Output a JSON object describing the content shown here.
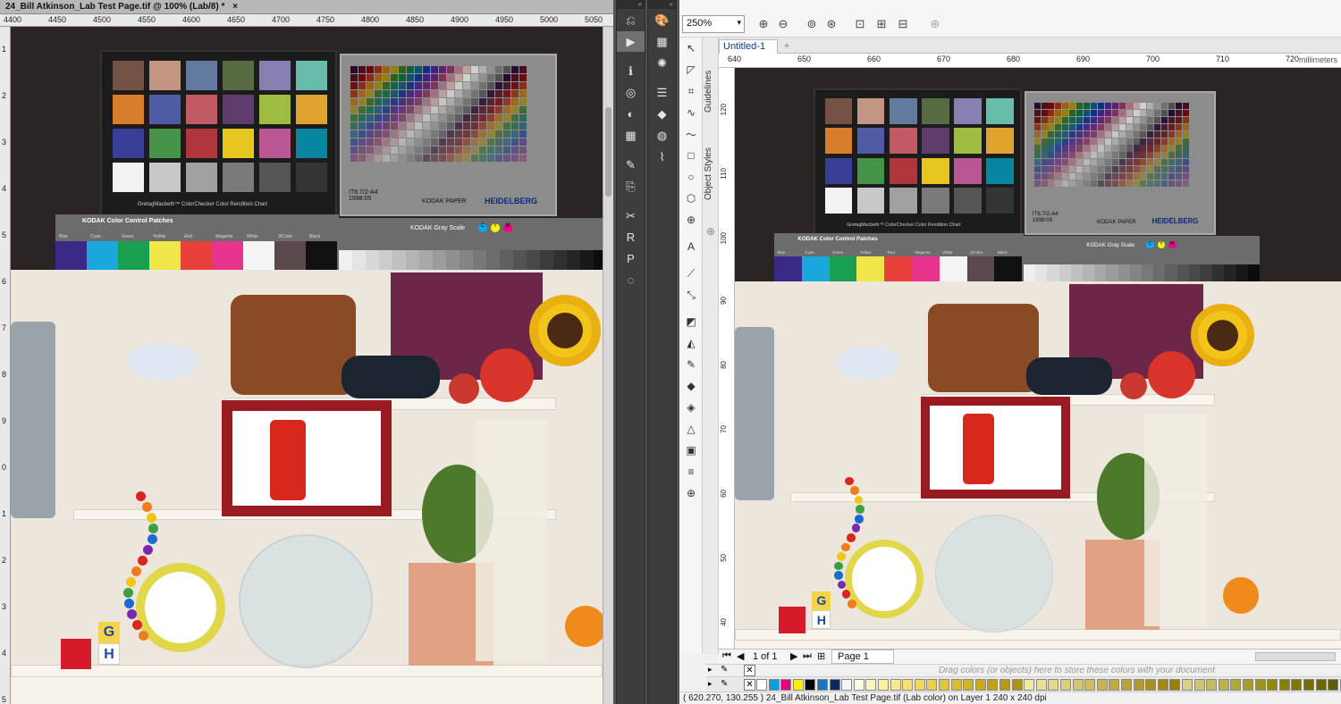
{
  "photoshop": {
    "tab_title": "24_Bill Atkinson_Lab Test Page.tif @ 100% (Lab/8) *",
    "close_glyph": "×",
    "ruler_top_ticks": [
      "4400",
      "4450",
      "4500",
      "4550",
      "4600",
      "4650",
      "4700",
      "4750",
      "4800",
      "4850",
      "4900",
      "4950",
      "5000",
      "5050"
    ],
    "ruler_left_ticks": [
      "1",
      "2",
      "3",
      "4",
      "5",
      "6",
      "7",
      "8",
      "9",
      "0",
      "1",
      "2",
      "3",
      "4",
      "5"
    ]
  },
  "test_image": {
    "colorchecker_caption": "GretagMacbeth™ ColorChecker Color Rendition Chart",
    "it8_label": "IT8.7/2-A4 1998:05",
    "kodak_paper": "KODAK PAPER",
    "heidelberg": "HEIDELBERG",
    "kodak_patches_title": "KODAK Color Control Patches",
    "kodak_patch_names": [
      "Blue",
      "Cyan",
      "Green",
      "Yellow",
      "Red",
      "Magenta",
      "White",
      "3/Color",
      "Black"
    ],
    "kodak_gray_title": "KODAK Gray Scale",
    "cmy": [
      "C",
      "Y",
      "M"
    ],
    "cube_letters": [
      "G",
      "H"
    ],
    "colors": {
      "colorchecker": [
        "#735244",
        "#c29682",
        "#627a9d",
        "#576c43",
        "#8580b1",
        "#67bdaa",
        "#d67e2c",
        "#505ba6",
        "#c15a63",
        "#5e3c6c",
        "#9dbc40",
        "#e0a32e",
        "#383d96",
        "#469449",
        "#af363c",
        "#e7c71f",
        "#bb5695",
        "#0885a1",
        "#f3f3f2",
        "#c8c8c8",
        "#a0a0a0",
        "#7a7a79",
        "#555555",
        "#343434"
      ],
      "kodak_patches": [
        "#3a2a86",
        "#1aa7dc",
        "#18a050",
        "#f0e64a",
        "#e8403a",
        "#e8338c",
        "#f4f4f4",
        "#5a4a4e",
        "#111111"
      ]
    }
  },
  "tool_strips": {
    "left": [
      "history-brush-icon",
      "play-icon",
      "info-icon",
      "color-wheel-icon",
      "adjustment-icon",
      "crop-extract-icon",
      "brush-settings-icon",
      "stamp-icon",
      "scissors-icon",
      "paragraph-style-icon",
      "paragraph-icon",
      "character-style-icon"
    ],
    "right": [
      "palette-icon",
      "grid-icon",
      "sun-icon",
      "sliders-icon",
      "layers-icon",
      "channels-icon",
      "path-icon"
    ],
    "glyphs_left": [
      "⎌",
      "▶",
      "ℹ",
      "◎",
      "◐",
      "▦",
      "✎",
      "⎘",
      "✂",
      "R",
      "P",
      "◌"
    ],
    "glyphs_right": [
      "🎨",
      "▦",
      "✺",
      "☰",
      "◆",
      "◍",
      "⌇"
    ]
  },
  "corel": {
    "zoom": "250%",
    "document_tab": "Untitled-1",
    "units": "millimeters",
    "ruler_top_ticks": [
      "640",
      "650",
      "660",
      "670",
      "680",
      "690",
      "700",
      "710",
      "720"
    ],
    "ruler_left_ticks": [
      "120",
      "110",
      "100",
      "90",
      "80",
      "70",
      "60",
      "50",
      "40"
    ],
    "dock_tabs": [
      "Guidelines",
      "Object Styles"
    ],
    "page_nav": "1 of 1",
    "page_tab": "Page 1",
    "doc_palette_hint": "Drag colors (or objects) here to store these colors with your document",
    "status": "( 620.270, 130.255 )      24_Bill Atkinson_Lab Test Page.tif (Lab color) on Layer 1 240 x 240 dpi",
    "palette_colors": [
      "#ffffff",
      "#00a0e0",
      "#e6007e",
      "#ffee00",
      "#000000",
      "#1a75bb",
      "#0a2a5c",
      "#f5f5f5",
      "#fffde0",
      "#fff6bf",
      "#fff0a0",
      "#ffe88a",
      "#f9e070",
      "#f0d860",
      "#e8cf4c",
      "#e0c63c",
      "#d8bd2e",
      "#d0b422",
      "#c8ab1a",
      "#c0a214",
      "#b89a10",
      "#b0920c",
      "#f2e8a8",
      "#ebe09a",
      "#e4d78c",
      "#ddce7e",
      "#d6c570",
      "#cfbc62",
      "#c8b354",
      "#c1aa46",
      "#baa138",
      "#b3982a",
      "#ac8f1c",
      "#a5860e",
      "#9e7d00",
      "#d9cf8a",
      "#cfc577",
      "#c5bb64",
      "#bbb151",
      "#b1a73e",
      "#a79d2b",
      "#9d9318",
      "#938905",
      "#8a8000",
      "#807700",
      "#766e00",
      "#6c6500",
      "#625c00",
      "#fbf3c4",
      "#f5ecb0",
      "#efe59c"
    ]
  }
}
